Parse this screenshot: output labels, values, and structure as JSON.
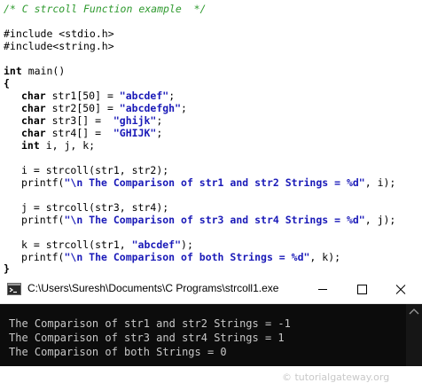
{
  "code": {
    "comment": "/* C strcoll Function example  */",
    "include1": "#include <stdio.h>",
    "include2": "#include<string.h>",
    "main_kw": "int",
    "main_rest": " main()",
    "open_brace": "{",
    "close_brace": "}",
    "decl1_kw": "char",
    "decl1_mid": " str1[50] = ",
    "decl1_str": "\"abcdef\"",
    "decl2_kw": "char",
    "decl2_mid": " str2[50] = ",
    "decl2_str": "\"abcdefgh\"",
    "decl3_kw": "char",
    "decl3_mid": " str3[] =  ",
    "decl3_str": "\"ghijk\"",
    "decl4_kw": "char",
    "decl4_mid": " str4[] =  ",
    "decl4_str": "\"GHIJK\"",
    "semi": ";",
    "decl5_kw": "int",
    "decl5_rest": " i, j, k;",
    "stmt_i": "i = strcoll(str1, str2);",
    "printf1_pre": "printf(",
    "printf1_str": "\"\\n The Comparison of str1 and str2 Strings = %d\"",
    "printf1_post": ", i);",
    "stmt_j": "j = strcoll(str3, str4);",
    "printf2_pre": "printf(",
    "printf2_str": "\"\\n The Comparison of str3 and str4 Strings = %d\"",
    "printf2_post": ", j);",
    "stmt_k_pre": "k = strcoll(str1, ",
    "stmt_k_str": "\"abcdef\"",
    "stmt_k_post": ");",
    "printf3_pre": "printf(",
    "printf3_str": "\"\\n The Comparison of both Strings = %d\"",
    "printf3_post": ", k);"
  },
  "console": {
    "title": "C:\\Users\\Suresh\\Documents\\C Programs\\strcoll1.exe",
    "output": [
      "The Comparison of str1 and str2 Strings = -1",
      "The Comparison of str3 and str4 Strings = 1",
      "The Comparison of both Strings = 0"
    ],
    "watermark": "© tutorialgateway.org"
  },
  "colors": {
    "comment": "#2f9a2f",
    "string": "#1a1ab8",
    "console_bg": "#0c0c0c",
    "console_text": "#c8c8c8"
  },
  "icons": [
    "console-app-icon",
    "minimize-icon",
    "maximize-icon",
    "close-icon",
    "scroll-up-arrow-icon"
  ]
}
